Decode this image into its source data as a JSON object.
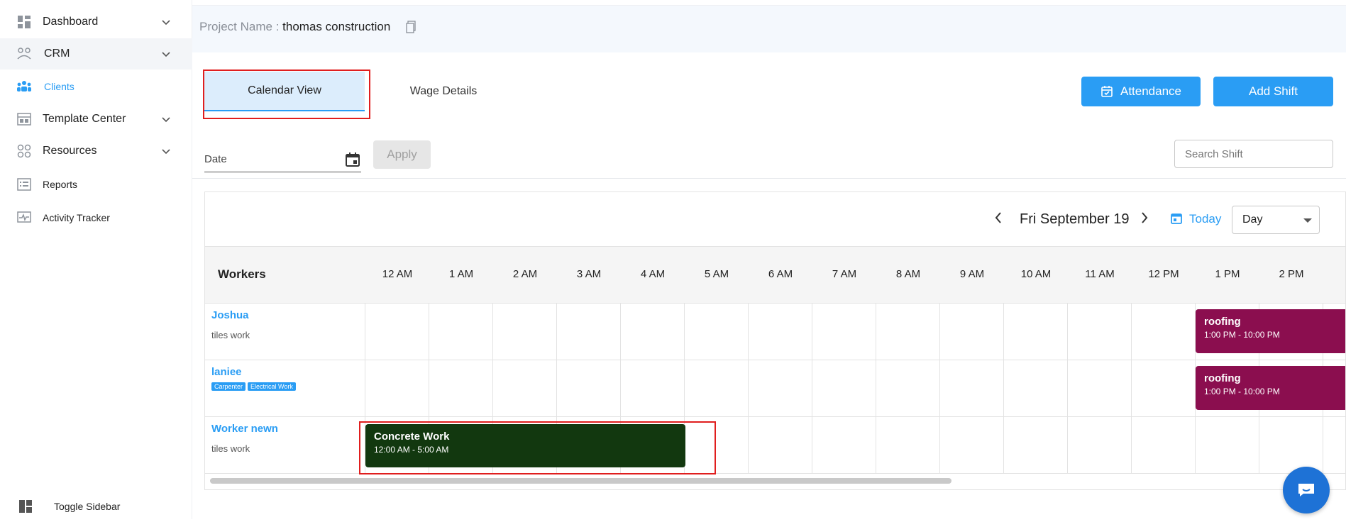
{
  "sidebar": {
    "items": [
      {
        "label": "Dashboard"
      },
      {
        "label": "CRM"
      },
      {
        "label": "Clients"
      },
      {
        "label": "Template Center"
      },
      {
        "label": "Resources"
      },
      {
        "label": "Reports"
      },
      {
        "label": "Activity Tracker"
      }
    ],
    "toggle_label": "Toggle Sidebar"
  },
  "header": {
    "project_label": "Project Name : ",
    "project_name": "thomas construction"
  },
  "tabs": [
    {
      "label": "Calendar View",
      "active": true
    },
    {
      "label": "Wage Details",
      "active": false
    }
  ],
  "actions": {
    "attendance_label": "Attendance",
    "add_shift_label": "Add Shift"
  },
  "filters": {
    "date_label": "Date",
    "apply_label": "Apply",
    "search_placeholder": "Search Shift"
  },
  "calendar": {
    "current_date": "Fri September 19",
    "today_label": "Today",
    "view": "Day",
    "workers_header": "Workers",
    "hours": [
      "12 AM",
      "1 AM",
      "2 AM",
      "3 AM",
      "4 AM",
      "5 AM",
      "6 AM",
      "7 AM",
      "8 AM",
      "9 AM",
      "10 AM",
      "11 AM",
      "12 PM",
      "1 PM",
      "2 PM"
    ],
    "workers": [
      {
        "name": "Joshua",
        "subtitle": "tiles work",
        "tags": []
      },
      {
        "name": "laniee",
        "subtitle": "",
        "tags": [
          "Carpenter",
          "Electrical Work"
        ]
      },
      {
        "name": "Worker newn",
        "subtitle": "tiles work",
        "tags": []
      }
    ],
    "events": [
      {
        "title": "roofing",
        "time": "1:00 PM - 10:00 PM",
        "worker": "Joshua",
        "color": "#8b0e4f"
      },
      {
        "title": "roofing",
        "time": "1:00 PM - 10:00 PM",
        "worker": "laniee",
        "color": "#8b0e4f"
      },
      {
        "title": "Concrete Work",
        "time": "12:00 AM - 5:00 AM",
        "worker": "Worker newn",
        "color": "#12380f"
      }
    ]
  },
  "colors": {
    "accent": "#2a9df4",
    "highlight_box": "#e01e1e"
  }
}
